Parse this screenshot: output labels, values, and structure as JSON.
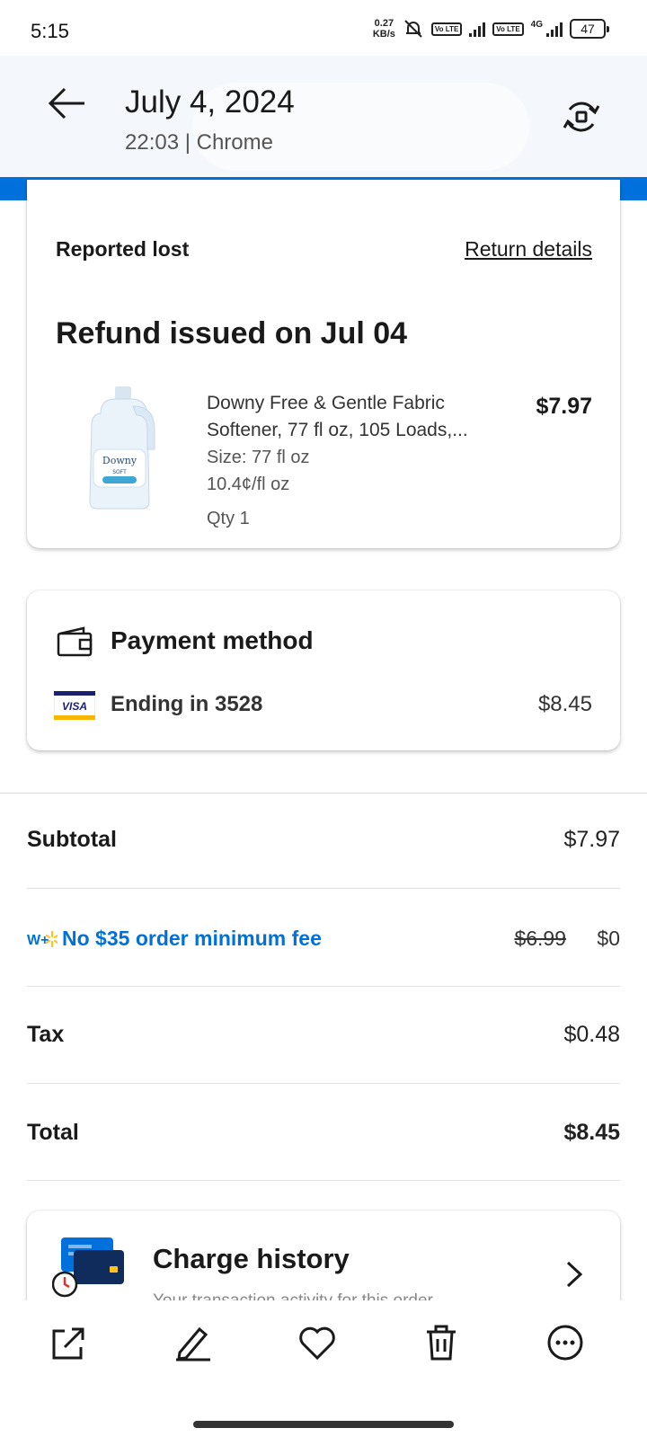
{
  "status_bar": {
    "time": "5:15",
    "net_speed": "0.27",
    "net_unit": "KB/s",
    "lte_label_1": "Vo LTE",
    "lte_label_2": "Vo LTE",
    "network_type": "4G",
    "battery": "47"
  },
  "header": {
    "title": "July 4, 2024",
    "subtitle": "22:03 | Chrome"
  },
  "refund_card": {
    "status": "Reported lost",
    "return_link": "Return details",
    "title": "Refund issued on Jul 04",
    "product": {
      "name": "Downy Free & Gentle Fabric Softener, 77 fl oz, 105 Loads,...",
      "size": "Size: 77 fl oz",
      "unit_price": "10.4¢/fl oz",
      "qty": "Qty 1",
      "price": "$7.97",
      "brand": "Downy",
      "brand_sub": "SOFT"
    }
  },
  "payment": {
    "title": "Payment method",
    "card_brand": "VISA",
    "ending": "Ending in 3528",
    "amount": "$8.45"
  },
  "summary": {
    "subtotal_label": "Subtotal",
    "subtotal_value": "$7.97",
    "fee_label": "No $35 order minimum fee",
    "fee_old": "$6.99",
    "fee_new": "$0",
    "tax_label": "Tax",
    "tax_value": "$0.48",
    "total_label": "Total",
    "total_value": "$8.45"
  },
  "charge_history": {
    "title": "Charge history",
    "subtitle": "Your transaction activity for this order"
  },
  "colors": {
    "walmart_blue": "#0071dc",
    "spark_yellow": "#ffc220"
  },
  "toolbar_icons": [
    "share-icon",
    "edit-icon",
    "heart-icon",
    "trash-icon",
    "more-icon"
  ]
}
